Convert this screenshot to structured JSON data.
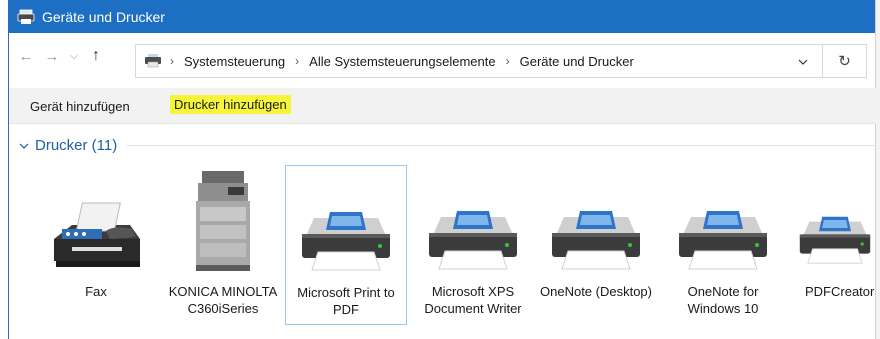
{
  "window": {
    "title": "Geräte und Drucker"
  },
  "nav": {
    "back": "←",
    "forward": "→",
    "recent": "⌵",
    "up": "↑",
    "refresh": "↻"
  },
  "breadcrumb": {
    "items": [
      "Systemsteuerung",
      "Alle Systemsteuerungselemente",
      "Geräte und Drucker"
    ],
    "separator": "›"
  },
  "commands": {
    "add_device": "Gerät hinzufügen",
    "add_printer": "Drucker hinzufügen"
  },
  "group": {
    "chevron": "⌄",
    "title": "Drucker (11)"
  },
  "devices": [
    {
      "label": "Fax",
      "icon": "fax-icon"
    },
    {
      "label": "KONICA MINOLTA C360iSeries",
      "icon": "copier-icon"
    },
    {
      "label": "Microsoft Print to PDF",
      "icon": "printer-icon",
      "selected": true
    },
    {
      "label": "Microsoft XPS Document Writer",
      "icon": "printer-icon"
    },
    {
      "label": "OneNote (Desktop)",
      "icon": "printer-icon"
    },
    {
      "label": "OneNote for Windows 10",
      "icon": "printer-icon"
    },
    {
      "label": "PDFCreator",
      "icon": "printer-icon"
    }
  ],
  "colors": {
    "titlebar": "#1d6fc3",
    "group_title": "#1f5fa8",
    "highlight": "#f7f53a",
    "selection_border": "#99c9ef"
  }
}
